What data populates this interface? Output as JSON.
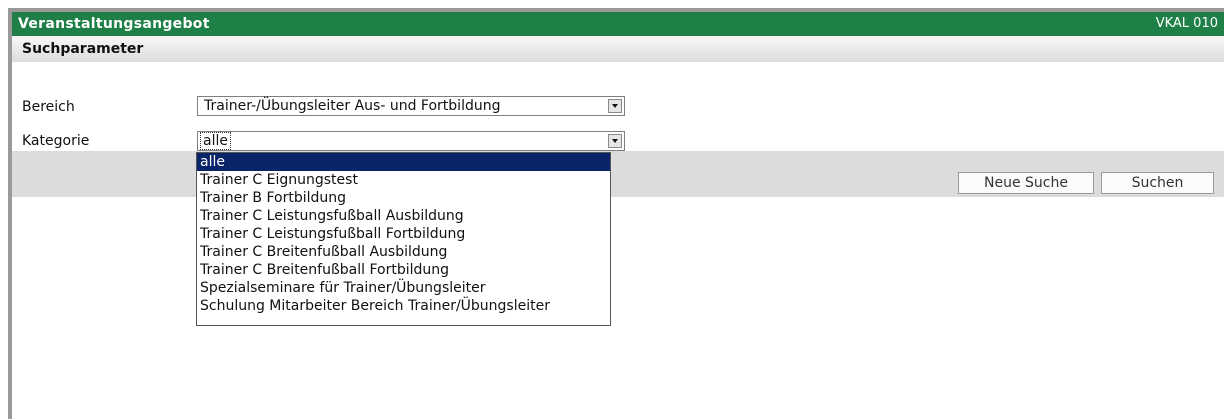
{
  "window": {
    "title": "Veranstaltungsangebot",
    "code": "VKAL 010"
  },
  "search": {
    "header": "Suchparameter",
    "bereich": {
      "label": "Bereich",
      "value": "Trainer-/Übungsleiter Aus- und Fortbildung"
    },
    "kategorie": {
      "label": "Kategorie",
      "value": "alle"
    }
  },
  "dropdown": {
    "options": [
      "alle",
      "Trainer C Eignungstest",
      "Trainer B Fortbildung",
      "Trainer C Leistungsfußball Ausbildung",
      "Trainer C Leistungsfußball Fortbildung",
      "Trainer C Breitenfußball Ausbildung",
      "Trainer C Breitenfußball Fortbildung",
      "Spezialseminare für Trainer/Übungsleiter",
      "Schulung Mitarbeiter Bereich Trainer/Übungsleiter"
    ],
    "selected_index": 0
  },
  "buttons": {
    "new_search": "Neue Suche",
    "search": "Suchen"
  },
  "colors": {
    "titlebar": "#1f8047",
    "selection": "#0a246a"
  }
}
